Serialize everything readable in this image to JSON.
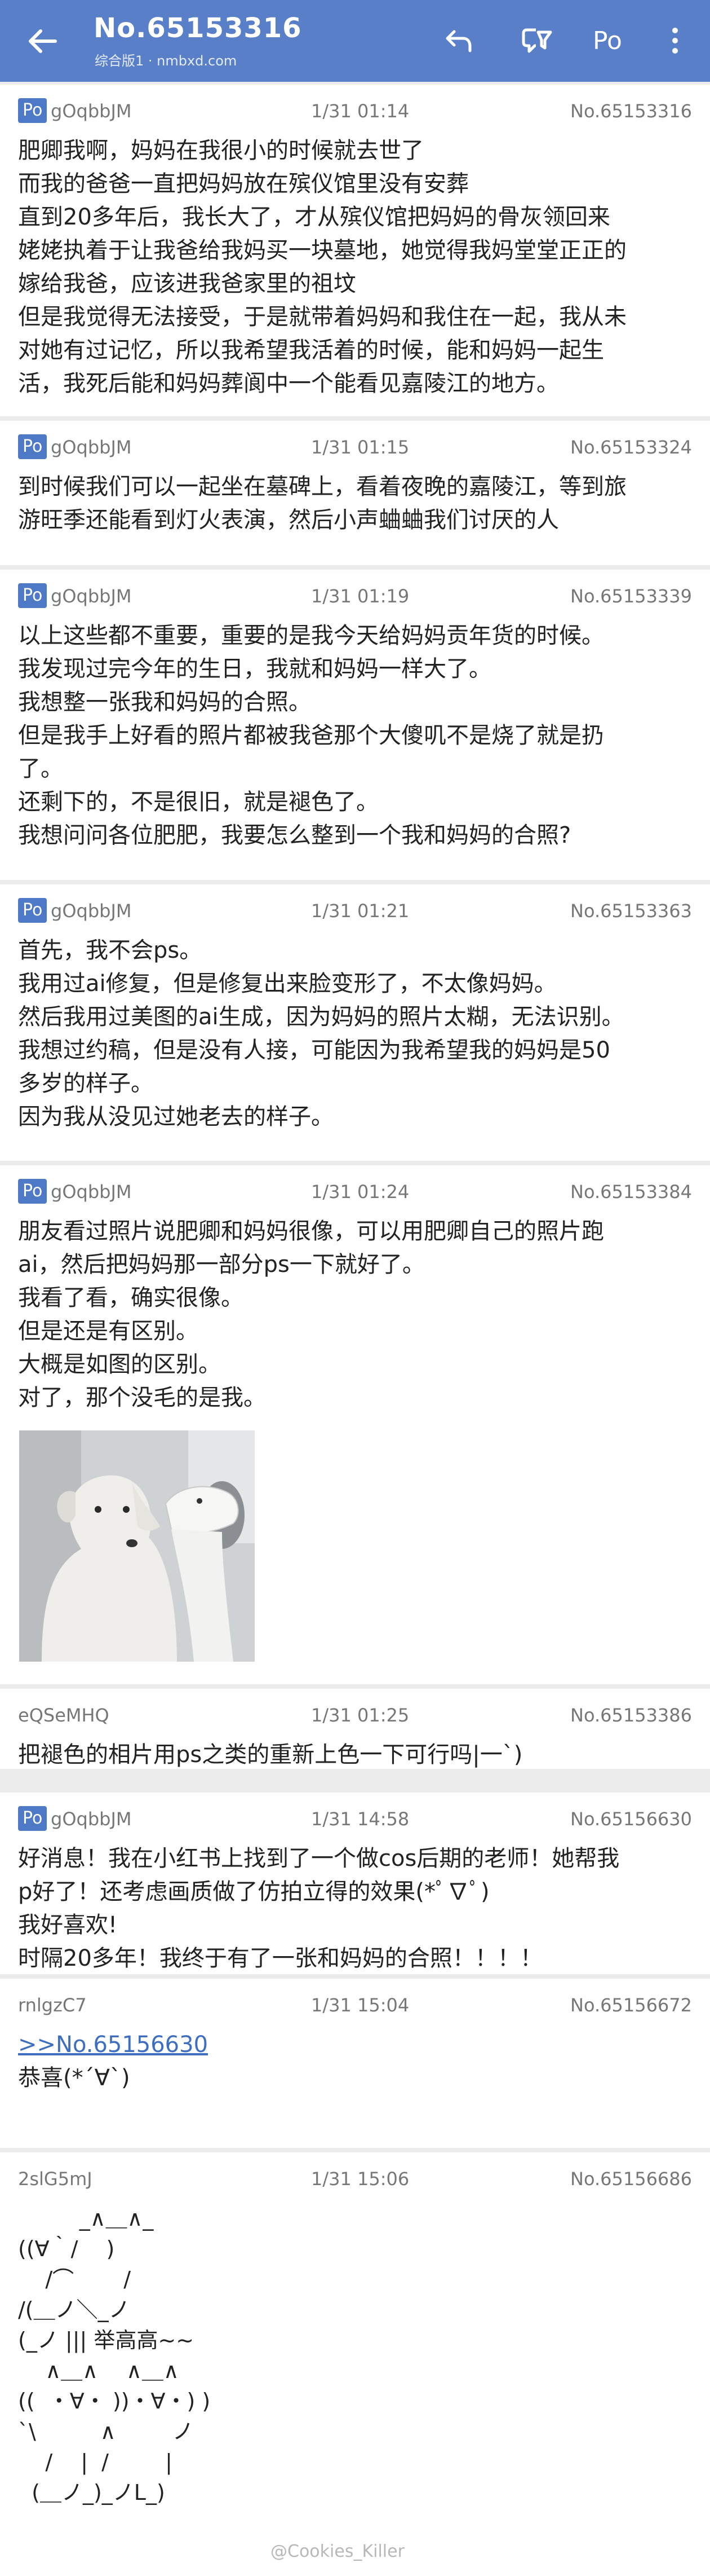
{
  "appbar": {
    "title": "No.65153316",
    "subtitle": "综合版1 · nmbxd.com",
    "po_button": "Po"
  },
  "posts": [
    {
      "po": "Po",
      "uid": "gOqbbJM",
      "time": "1/31 01:14",
      "no": "No.65153316",
      "lines": [
        "肥卿我啊，妈妈在我很小的时候就去世了",
        "而我的爸爸一直把妈妈放在殡仪馆里没有安葬",
        "直到20多年后，我长大了，才从殡仪馆把妈妈的骨灰领回来",
        "姥姥执着于让我爸给我妈买一块墓地，她觉得我妈堂堂正正的",
        "嫁给我爸，应该进我爸家里的祖坟",
        "但是我觉得无法接受，于是就带着妈妈和我住在一起，我从未",
        "对她有过记忆，所以我希望我活着的时候，能和妈妈一起生",
        "活，我死后能和妈妈葬阆中一个能看见嘉陵江的地方。"
      ]
    },
    {
      "po": "Po",
      "uid": "gOqbbJM",
      "time": "1/31 01:15",
      "no": "No.65153324",
      "lines": [
        "到时候我们可以一起坐在墓碑上，看着夜晚的嘉陵江，等到旅",
        "游旺季还能看到灯火表演，然后小声蛐蛐我们讨厌的人"
      ]
    },
    {
      "po": "Po",
      "uid": "gOqbbJM",
      "time": "1/31 01:19",
      "no": "No.65153339",
      "lines": [
        "以上这些都不重要，重要的是我今天给妈妈贡年货的时候。",
        "我发现过完今年的生日，我就和妈妈一样大了。",
        "我想整一张我和妈妈的合照。",
        "但是我手上好看的照片都被我爸那个大傻叽不是烧了就是扔",
        "了。",
        "还剩下的，不是很旧，就是褪色了。",
        "我想问问各位肥肥，我要怎么整到一个我和妈妈的合照?"
      ]
    },
    {
      "po": "Po",
      "uid": "gOqbbJM",
      "time": "1/31 01:21",
      "no": "No.65153363",
      "lines": [
        "首先，我不会ps。",
        "我用过ai修复，但是修复出来脸变形了，不太像妈妈。",
        "然后我用过美图的ai生成，因为妈妈的照片太糊，无法识别。",
        "我想过约稿，但是没有人接，可能因为我希望我的妈妈是50",
        "多岁的样子。",
        "因为我从没见过她老去的样子。"
      ]
    },
    {
      "po": "Po",
      "uid": "gOqbbJM",
      "time": "1/31 01:24",
      "no": "No.65153384",
      "lines": [
        "朋友看过照片说肥卿和妈妈很像，可以用肥卿自己的照片跑",
        "ai，然后把妈妈那一部分ps一下就好了。",
        "我看了看，确实很像。",
        "但是还是有区别。",
        "大概是如图的区别。",
        "对了，那个没毛的是我。"
      ]
    },
    {
      "uid": "eQSeMHQ",
      "time": "1/31 01:25",
      "no": "No.65153386",
      "lines": [
        "把褪色的相片用ps之类的重新上色一下可行吗|一`)"
      ]
    },
    {
      "po": "Po",
      "uid": "gOqbbJM",
      "time": "1/31 14:58",
      "no": "No.65156630",
      "lines": [
        "好消息！我在小红书上找到了一个做cos后期的老师！她帮我",
        "p好了！还考虑画质做了仿拍立得的效果(*ﾟ∇ﾟ)",
        "我好喜欢!",
        "时隔20多年！我终于有了一张和妈妈的合照！！！！"
      ]
    },
    {
      "uid": "rnlgzC7",
      "time": "1/31 15:04",
      "no": "No.65156672",
      "quote": ">>No.65156630",
      "lines": [
        "恭喜(*´∀`)"
      ]
    },
    {
      "uid": "2slG5mJ",
      "time": "1/31 15:06",
      "no": "No.65156686",
      "lines": [
        "         _∧＿∧_",
        "((∀｀/　 )",
        "    /⌒　　 /",
        "/(＿ノ＼_ノ",
        "(_ノ ||| 举高高~~",
        "    ∧＿∧　 ∧＿∧",
        "((  ・∀・ ))・∀・) )",
        "`\\　　　∧　　  ノ",
        "    /　 |  /　　  |",
        "  (＿ノ_)_ノL_)"
      ]
    }
  ],
  "watermark": "@Cookies_Killer"
}
